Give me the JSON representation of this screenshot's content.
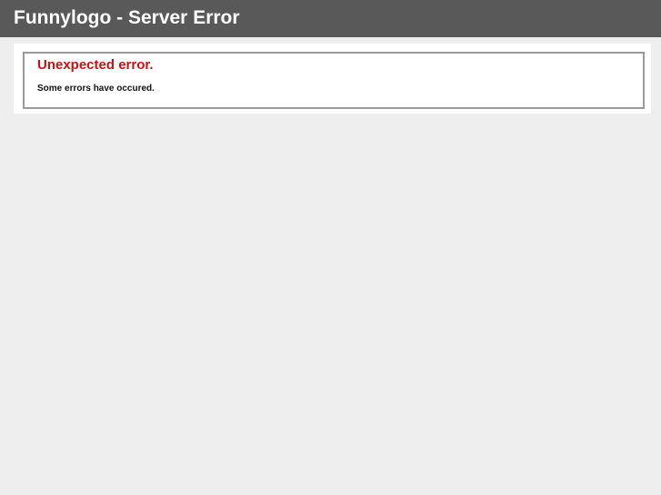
{
  "header": {
    "title": "Funnylogo - Server Error"
  },
  "error": {
    "title": "Unexpected error.",
    "message": "Some errors have occured."
  },
  "colors": {
    "header_background": "#595959",
    "page_background": "#eeeeee",
    "error_title": "#cc1111"
  }
}
